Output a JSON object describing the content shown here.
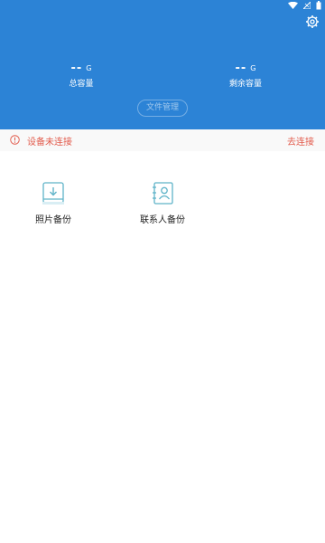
{
  "header": {
    "total": {
      "value": "--",
      "unit": "G",
      "label": "总容量"
    },
    "free": {
      "value": "--",
      "unit": "G",
      "label": "剩余容量"
    },
    "file_button_label": "文件管理"
  },
  "connection": {
    "status": "设备未连接",
    "action": "去连接",
    "accent": "#e25a4b"
  },
  "tiles": [
    {
      "label": "照片备份",
      "icon": "photo-download-icon"
    },
    {
      "label": "联系人备份",
      "icon": "contacts-icon"
    }
  ],
  "colors": {
    "header_bg": "#2c83d6",
    "icon_accent": "#5fb3c8"
  }
}
